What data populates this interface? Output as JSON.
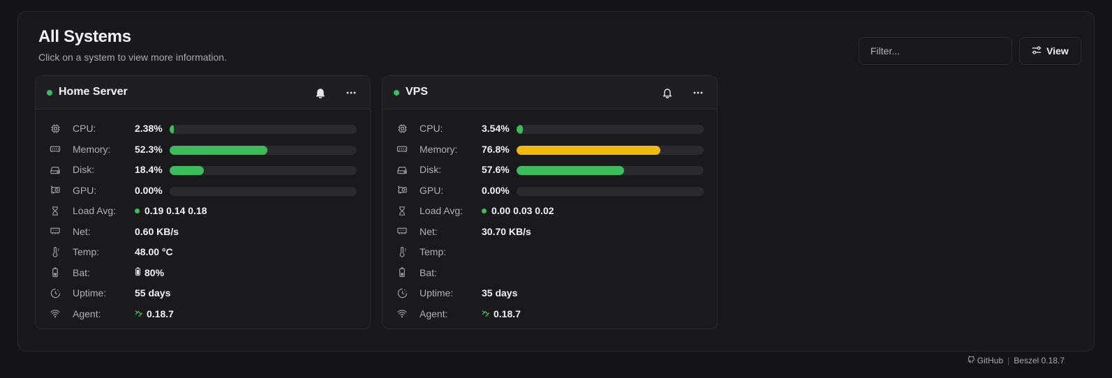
{
  "header": {
    "title": "All Systems",
    "subtitle": "Click on a system to view more information.",
    "filter_placeholder": "Filter...",
    "view_label": "View"
  },
  "colors": {
    "ok": "#3bbd5c",
    "warn": "#f0b90b",
    "status_up": "#34c25a"
  },
  "systems": [
    {
      "name": "Home Server",
      "status": "up",
      "cpu": {
        "label": "CPU:",
        "value": "2.38%",
        "percent": 2.38
      },
      "memory": {
        "label": "Memory:",
        "value": "52.3%",
        "percent": 52.3
      },
      "disk": {
        "label": "Disk:",
        "value": "18.4%",
        "percent": 18.4
      },
      "gpu": {
        "label": "GPU:",
        "value": "0.00%",
        "percent": 0
      },
      "load": {
        "label": "Load Avg:",
        "value": "0.19 0.14 0.18"
      },
      "net": {
        "label": "Net:",
        "value": "0.60 KB/s"
      },
      "temp": {
        "label": "Temp:",
        "value": "48.00 °C"
      },
      "bat": {
        "label": "Bat:",
        "value": "80%"
      },
      "uptime": {
        "label": "Uptime:",
        "value": "55 days"
      },
      "agent": {
        "label": "Agent:",
        "value": "0.18.7"
      }
    },
    {
      "name": "VPS",
      "status": "up",
      "cpu": {
        "label": "CPU:",
        "value": "3.54%",
        "percent": 3.54
      },
      "memory": {
        "label": "Memory:",
        "value": "76.8%",
        "percent": 76.8
      },
      "disk": {
        "label": "Disk:",
        "value": "57.6%",
        "percent": 57.6
      },
      "gpu": {
        "label": "GPU:",
        "value": "0.00%",
        "percent": 0
      },
      "load": {
        "label": "Load Avg:",
        "value": "0.00 0.03 0.02"
      },
      "net": {
        "label": "Net:",
        "value": "30.70 KB/s"
      },
      "temp": {
        "label": "Temp:",
        "value": ""
      },
      "bat": {
        "label": "Bat:",
        "value": ""
      },
      "uptime": {
        "label": "Uptime:",
        "value": "35 days"
      },
      "agent": {
        "label": "Agent:",
        "value": "0.18.7"
      }
    }
  ],
  "footer": {
    "github": "GitHub",
    "separator": "|",
    "version": "Beszel 0.18.7"
  },
  "icons": {
    "cpu": "cpu-icon",
    "memory": "memory-icon",
    "disk": "disk-icon",
    "gpu": "gpu-icon",
    "load": "hourglass-icon",
    "net": "network-icon",
    "temp": "thermometer-icon",
    "bat": "battery-icon",
    "uptime": "clock-icon",
    "agent": "wifi-icon"
  }
}
